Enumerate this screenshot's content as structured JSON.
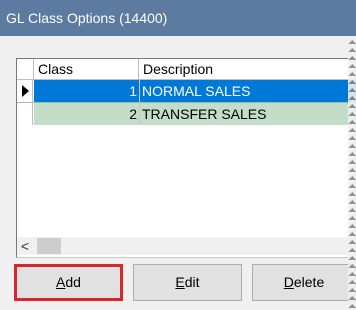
{
  "window": {
    "title": "GL Class Options (14400)",
    "titlebar_color": "#5d7aa0"
  },
  "grid": {
    "columns": [
      "Class",
      "Description"
    ],
    "rows": [
      {
        "class": "1",
        "description": "NORMAL SALES",
        "selected": true
      },
      {
        "class": "2",
        "description": "TRANSFER SALES",
        "selected": false
      }
    ],
    "selected_color": "#0078d7",
    "alt_row_color": "#c3dec8"
  },
  "scrollbar": {
    "left_arrow": "<"
  },
  "buttons": {
    "add": {
      "prefix": "",
      "mnemonic": "A",
      "rest": "dd"
    },
    "edit": {
      "prefix": "",
      "mnemonic": "E",
      "rest": "dit"
    },
    "delete": {
      "prefix": "",
      "mnemonic": "D",
      "rest": "elete"
    },
    "highlight_color": "#d9262e"
  }
}
